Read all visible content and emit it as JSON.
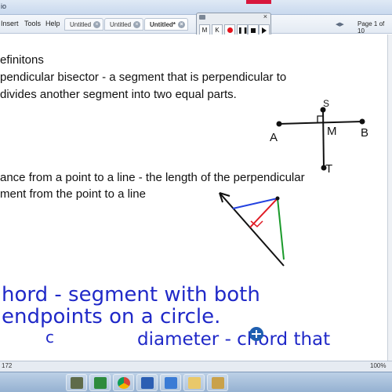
{
  "titlebar": {
    "title": "io"
  },
  "menu": {
    "insert": "Insert",
    "tools": "Tools",
    "help": "Help"
  },
  "tabs": [
    {
      "label": "Untitled"
    },
    {
      "label": "Untitled"
    },
    {
      "label": "Untitled*"
    }
  ],
  "page_indicator": "Page 1 of 10",
  "recorder": {
    "m_label": "M",
    "k_label": "K"
  },
  "board": {
    "heading": "efinitons",
    "perp_line1": "pendicular bisector - a segment that is perpendicular to",
    "perp_line2": "divides another segment into two equal parts.",
    "dist_line1": "ance from a point to a line - the length of the perpendicular",
    "dist_line2": "ment from the point to a line",
    "diagram_labels": {
      "s": "S",
      "a": "A",
      "m": "M",
      "b": "B",
      "t": "T"
    },
    "handwriting": {
      "line1": "hord - segment with both",
      "line2": "endpoints on a circle.",
      "line3a": "c",
      "line3b": "diameter - chord that"
    }
  },
  "statusbar": {
    "left_number": "172",
    "zoom": "100%"
  },
  "taskbar_icons": [
    "file-manager-icon",
    "excel-icon",
    "chrome-icon",
    "word-icon",
    "app-icon",
    "notes-icon",
    "paint-icon"
  ],
  "colors": {
    "handwriting_blue": "#2029c8",
    "diagram_red": "#e01b24",
    "diagram_green": "#1a9a2a",
    "diagram_blue": "#2342e0",
    "record_red": "#e3121b"
  }
}
